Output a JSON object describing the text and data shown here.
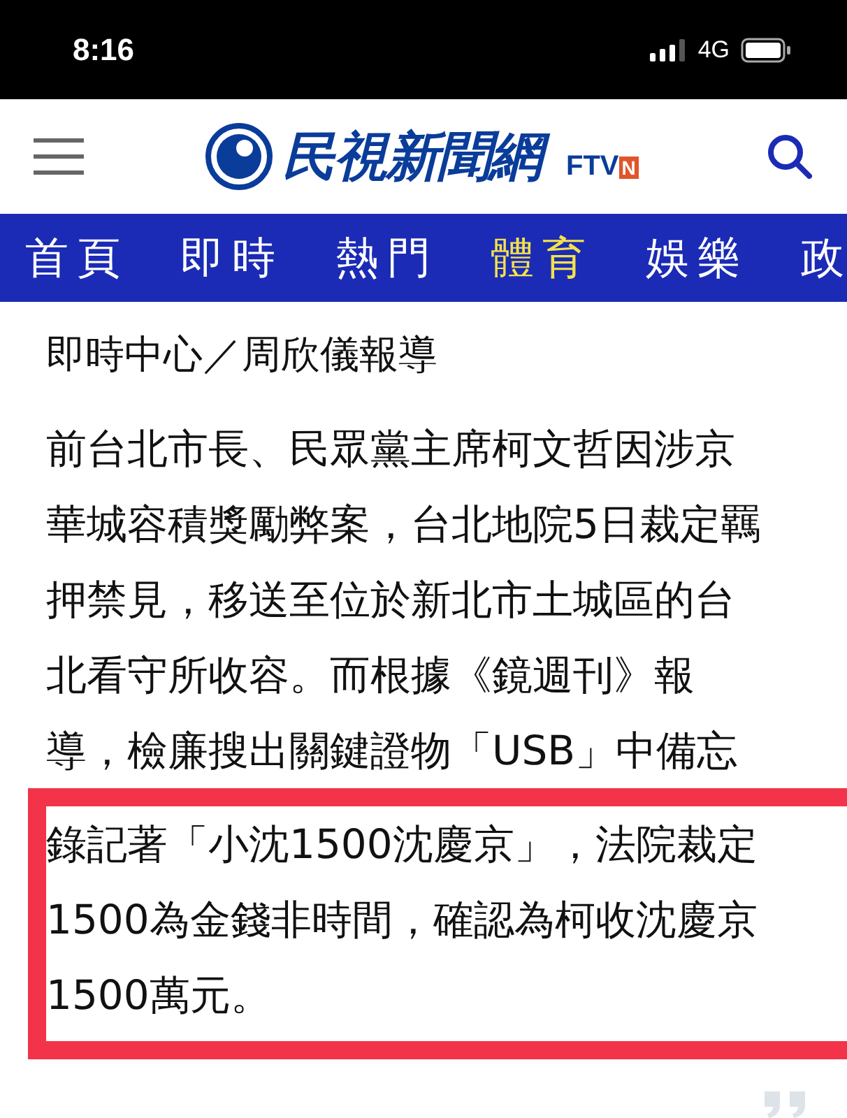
{
  "status_bar": {
    "time": "8:16",
    "network": "4G"
  },
  "header": {
    "logo_text": "民視新聞網",
    "logo_sub": "FTV",
    "logo_badge": "N"
  },
  "nav": [
    {
      "label": "首頁",
      "selected": false
    },
    {
      "label": "即時",
      "selected": false
    },
    {
      "label": "熱門",
      "selected": false
    },
    {
      "label": "體育",
      "selected": true
    },
    {
      "label": "娛樂",
      "selected": false
    },
    {
      "label": "政",
      "selected": false
    }
  ],
  "article": {
    "byline": "即時中心／周欣儀報導",
    "lines": [
      "前台北市長、民眾黨主席柯文哲因涉京",
      "華城容積獎勵弊案，台北地院5日裁定羈",
      "押禁見，移送至位於新北市土城區的台",
      "北看守所收容。而根據《鏡週刊》報",
      "導，檢廉搜出關鍵證物「USB」中備忘"
    ],
    "highlighted_lines": [
      "錄記著「小沈1500沈慶京」，法院裁定",
      "1500為金錢非時間，確認為柯收沈慶京",
      "1500萬元。"
    ]
  }
}
